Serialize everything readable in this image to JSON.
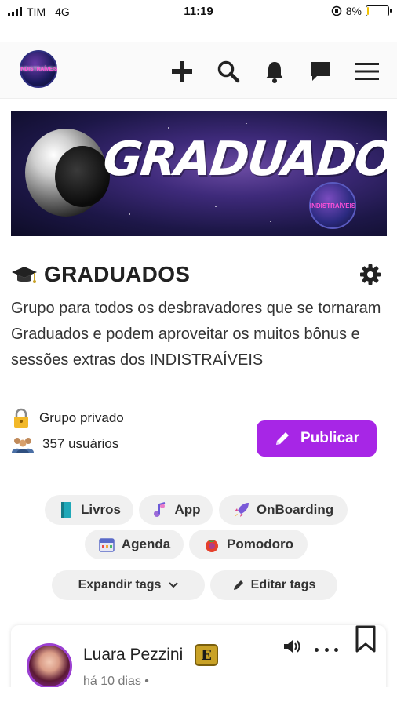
{
  "status_bar": {
    "carrier": "TIM",
    "network": "4G",
    "time": "11:19",
    "battery_percent": "8%",
    "battery_level": 0.08
  },
  "nav": {
    "logo_text": "INDISTRAÍVEIS",
    "icons": [
      "plus-icon",
      "search-icon",
      "bell-icon",
      "chat-icon",
      "menu-icon"
    ]
  },
  "banner": {
    "title": "GRADUADOS",
    "badge_text": "INDISTRAÍVEIS"
  },
  "group": {
    "title": "GRADUADOS",
    "description": "Grupo para todos os desbravadores que se tornaram Graduados e podem aproveitar os muitos bônus e sessões extras dos INDISTRAÍVEIS",
    "privacy": "Grupo privado",
    "users": "357 usuários",
    "publish_label": "Publicar"
  },
  "tags": {
    "livros": "Livros",
    "app": "App",
    "onboarding": "OnBoarding",
    "agenda": "Agenda",
    "pomodoro": "Pomodoro",
    "expand": "Expandir tags",
    "edit": "Editar tags"
  },
  "post": {
    "author": "Luara Pezzini",
    "badge": "E",
    "time": "há 10 dias •"
  },
  "colors": {
    "accent": "#a726e6",
    "tag_bg": "#f0f0f0",
    "battery": "#f2c200"
  }
}
